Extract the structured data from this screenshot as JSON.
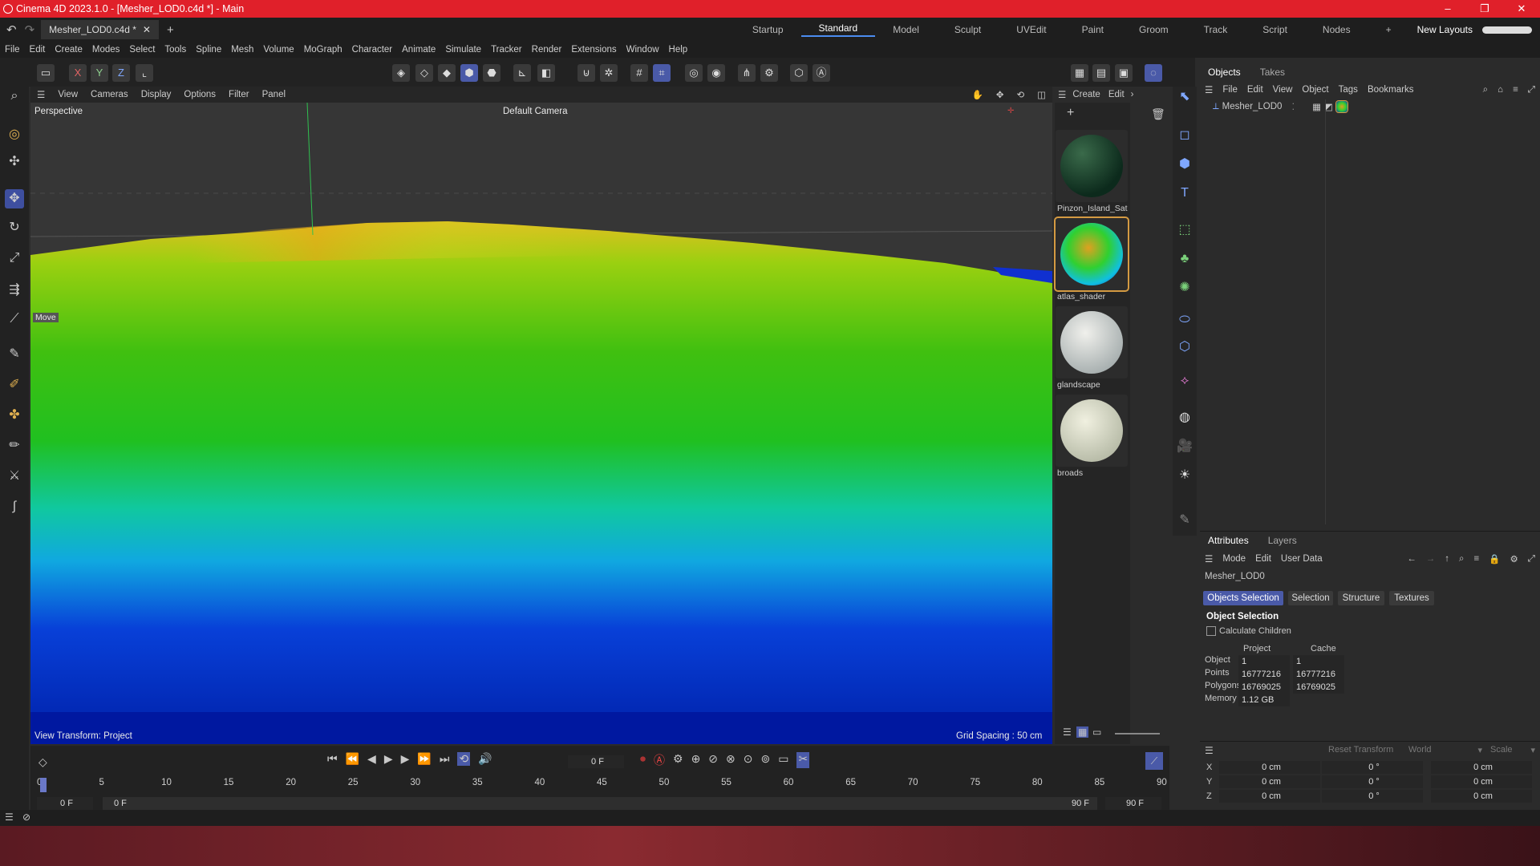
{
  "window": {
    "title": "Cinema 4D 2023.1.0 - [Mesher_LOD0.c4d *] - Main",
    "min": "–",
    "max": "❐",
    "close": "✕"
  },
  "tabs": {
    "doc": "Mesher_LOD0.c4d *",
    "add": "+"
  },
  "layouts": {
    "items": [
      "Startup",
      "Standard",
      "Model",
      "Sculpt",
      "UVEdit",
      "Paint",
      "Groom",
      "Track",
      "Script",
      "Nodes"
    ],
    "plus": "+",
    "new_layouts": "New Layouts"
  },
  "menu": [
    "File",
    "Edit",
    "Create",
    "Modes",
    "Select",
    "Tools",
    "Spline",
    "Mesh",
    "Volume",
    "MoGraph",
    "Character",
    "Animate",
    "Simulate",
    "Tracker",
    "Render",
    "Extensions",
    "Window",
    "Help"
  ],
  "toolbar": {
    "x": "X",
    "y": "Y",
    "z": "Z"
  },
  "viewport": {
    "menu": [
      "View",
      "Cameras",
      "Display",
      "Options",
      "Filter",
      "Panel"
    ],
    "label": "Perspective",
    "camera": "Default Camera",
    "move_label": "Move",
    "view_transform": "View Transform: Project",
    "grid_spacing": "Grid Spacing : 50 cm"
  },
  "materials": {
    "menu": [
      "Create",
      "Edit"
    ],
    "items": [
      {
        "name": "Pinzon_Island_Sat"
      },
      {
        "name": "atlas_shader"
      },
      {
        "name": "glandscape"
      },
      {
        "name": "broads"
      }
    ]
  },
  "objects": {
    "tabs": [
      "Objects",
      "Takes"
    ],
    "menu": [
      "File",
      "Edit",
      "View",
      "Object",
      "Tags",
      "Bookmarks"
    ],
    "items": [
      {
        "name": "Mesher_LOD0"
      }
    ]
  },
  "attributes": {
    "tabs": [
      "Attributes",
      "Layers"
    ],
    "menu": [
      "Mode",
      "Edit",
      "User Data"
    ],
    "object_name": "Mesher_LOD0",
    "sub_tabs": [
      "Objects Selection",
      "Selection",
      "Structure",
      "Textures"
    ],
    "section": "Object Selection",
    "calc_children": "Calculate Children",
    "col_project": "Project",
    "col_cache": "Cache",
    "rows": [
      {
        "label": "Object",
        "project": "1",
        "cache": "1"
      },
      {
        "label": "Points",
        "project": "16777216",
        "cache": "16777216"
      },
      {
        "label": "Polygons",
        "project": "16769025",
        "cache": "16769025"
      },
      {
        "label": "Memory",
        "project": "1.12 GB",
        "cache": ""
      }
    ]
  },
  "coords": {
    "reset": "Reset Transform",
    "world": "World",
    "scale": "Scale",
    "rows": [
      {
        "axis": "X",
        "pos": "0 cm",
        "rot": "0 °",
        "size": "0 cm"
      },
      {
        "axis": "Y",
        "pos": "0 cm",
        "rot": "0 °",
        "size": "0 cm"
      },
      {
        "axis": "Z",
        "pos": "0 cm",
        "rot": "0 °",
        "size": "0 cm"
      }
    ]
  },
  "timeline": {
    "frame": "0 F",
    "ticks": [
      "0",
      "5",
      "10",
      "15",
      "20",
      "25",
      "30",
      "35",
      "40",
      "45",
      "50",
      "55",
      "60",
      "65",
      "70",
      "75",
      "80",
      "85",
      "90"
    ],
    "start": "0 F",
    "start2": "0 F",
    "end": "90 F",
    "end2": "90 F"
  }
}
